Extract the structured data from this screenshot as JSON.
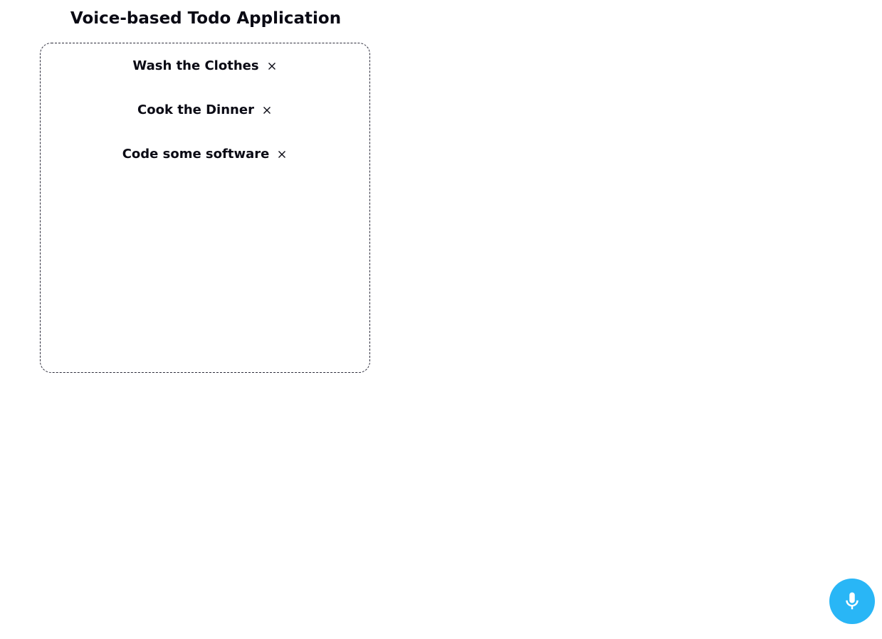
{
  "app": {
    "title": "Voice-based Todo Application"
  },
  "todos": [
    {
      "text": "Wash the Clothes",
      "remove_icon": "close-icon"
    },
    {
      "text": "Cook the Dinner",
      "remove_icon": "close-icon"
    },
    {
      "text": "Code some software",
      "remove_icon": "close-icon"
    }
  ],
  "mic": {
    "icon": "microphone-icon",
    "color": "#29b6f6"
  }
}
